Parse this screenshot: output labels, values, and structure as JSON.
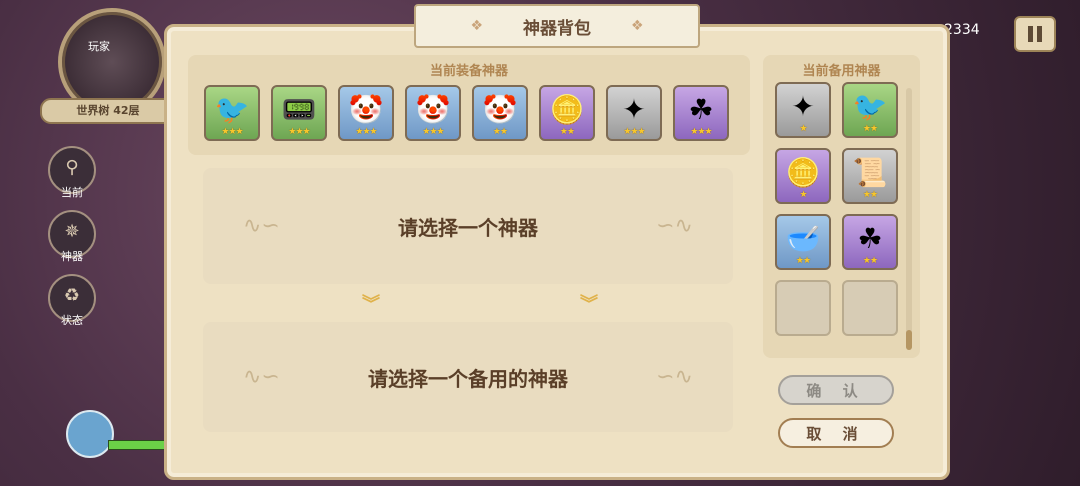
{
  "hud": {
    "map_label": "玩家",
    "floor_label": "世界树 42层",
    "side_buttons": [
      {
        "label": "当前",
        "icon": "location-pin-icon"
      },
      {
        "label": "神器",
        "icon": "artifact-star-icon"
      },
      {
        "label": "状态",
        "icon": "recycle-status-icon"
      }
    ],
    "score": "2334"
  },
  "dialog": {
    "title": "神器背包",
    "equipped_header": "当前装备神器",
    "spare_header": "当前备用神器",
    "equipped": [
      {
        "icon": "pigeon-icon",
        "glyph": "🐦",
        "rarity": "green",
        "stars": 3
      },
      {
        "icon": "phone-device-icon",
        "glyph": "📟",
        "rarity": "green",
        "stars": 3
      },
      {
        "icon": "clown-mask-icon",
        "glyph": "🤡",
        "rarity": "blue",
        "stars": 3
      },
      {
        "icon": "clown-mask-icon",
        "glyph": "🤡",
        "rarity": "blue",
        "stars": 3
      },
      {
        "icon": "clown-mask-icon",
        "glyph": "🤡",
        "rarity": "blue",
        "stars": 2
      },
      {
        "icon": "gold-coin-icon",
        "glyph": "🪙",
        "rarity": "purple",
        "stars": 2
      },
      {
        "icon": "shuriken-icon",
        "glyph": "✦",
        "rarity": "gray",
        "stars": 3
      },
      {
        "icon": "clover-cannon-icon",
        "glyph": "☘",
        "rarity": "purple",
        "stars": 3
      }
    ],
    "spare": [
      {
        "icon": "shuriken-icon",
        "glyph": "✦",
        "rarity": "gray",
        "stars": 1
      },
      {
        "icon": "pigeon-icon",
        "glyph": "🐦",
        "rarity": "green",
        "stars": 2
      },
      {
        "icon": "gold-coin-icon",
        "glyph": "🪙",
        "rarity": "purple",
        "stars": 1
      },
      {
        "icon": "scroll-tube-icon",
        "glyph": "📜",
        "rarity": "gray",
        "stars": 2
      },
      {
        "icon": "soup-bowl-icon",
        "glyph": "🥣",
        "rarity": "blue",
        "stars": 2
      },
      {
        "icon": "clover-cannon-icon",
        "glyph": "☘",
        "rarity": "purple",
        "stars": 2
      },
      {
        "icon": "empty-slot",
        "glyph": "",
        "rarity": "empty",
        "stars": 0
      },
      {
        "icon": "empty-slot",
        "glyph": "",
        "rarity": "empty",
        "stars": 0
      }
    ],
    "select_artifact": "请选择一个神器",
    "select_spare": "请选择一个备用的神器",
    "confirm_label": "确 认",
    "cancel_label": "取 消"
  }
}
